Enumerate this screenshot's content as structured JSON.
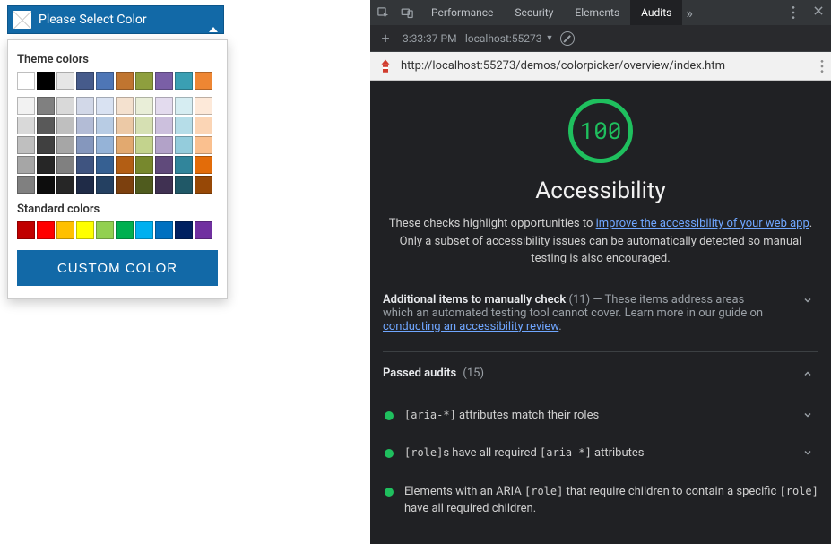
{
  "picker": {
    "placeholder": "Please Select Color",
    "theme_header": "Theme colors",
    "standard_header": "Standard colors",
    "custom_button": "CUSTOM COLOR",
    "theme_rows": [
      [
        "#ffffff",
        "#000000",
        "#e6e6e6",
        "#465b8b",
        "#4e76b6",
        "#c07530",
        "#8e9f3e",
        "#7a5fa6",
        "#3a9fb3",
        "#ee8633"
      ],
      [
        "#f2f2f2",
        "#808080",
        "#d9d9d9",
        "#d2d8e8",
        "#d9e2f2",
        "#f4e1cf",
        "#e9eed8",
        "#e3dbee",
        "#d6edf2",
        "#fde9d9"
      ],
      [
        "#d9d9d9",
        "#595959",
        "#bfbfbf",
        "#b3bcd6",
        "#b8cce4",
        "#ecc9a6",
        "#d6e0b3",
        "#ccc0dd",
        "#b6dde8",
        "#fbd5b5"
      ],
      [
        "#bfbfbf",
        "#404040",
        "#a6a6a6",
        "#8597bd",
        "#95b3d7",
        "#e2a96f",
        "#c3d38d",
        "#b2a2c8",
        "#94ccdc",
        "#fac08f"
      ],
      [
        "#a6a6a6",
        "#262626",
        "#808080",
        "#3f5480",
        "#366092",
        "#b35e14",
        "#77882d",
        "#604a7b",
        "#31859b",
        "#e36c09"
      ],
      [
        "#808080",
        "#0d0d0d",
        "#262626",
        "#1f2b47",
        "#244061",
        "#7c400e",
        "#4f5b1e",
        "#403152",
        "#205867",
        "#974806"
      ]
    ],
    "standard_colors": [
      "#c00000",
      "#ff0000",
      "#ffc000",
      "#ffff00",
      "#92d050",
      "#00b050",
      "#00b0f0",
      "#0070c0",
      "#002060",
      "#7030a0"
    ]
  },
  "devtools": {
    "tabs": [
      "Performance",
      "Security",
      "Elements",
      "Audits"
    ],
    "active_tab": "Audits",
    "timestamp": "3:33:37 PM - localhost:55273",
    "url": "http://localhost:55273/demos/colorpicker/overview/index.htm",
    "gauge_score": "100",
    "gauge_title": "Accessibility",
    "gauge_desc_prefix": "These checks highlight opportunities to ",
    "gauge_desc_link1": "improve the accessibility of your web app",
    "gauge_desc_suffix": ". Only a subset of accessibility issues can be automatically detected so manual testing is also encouraged.",
    "manual": {
      "title": "Additional items to manually check",
      "count": "(11)",
      "dash": "  —  ",
      "desc": "These items address areas which an automated testing tool cannot cover. Learn more in our guide on ",
      "link": "conducting an accessibility review",
      "period": "."
    },
    "passed": {
      "title": "Passed audits",
      "count": "(15)"
    },
    "audits": [
      {
        "pre": "",
        "code1": "[aria-*]",
        "mid": " attributes match their roles",
        "code2": "",
        "post": ""
      },
      {
        "pre": "",
        "code1": "[role]",
        "mid": "s have all required ",
        "code2": "[aria-*]",
        "post": " attributes"
      },
      {
        "pre": "Elements with an ARIA ",
        "code1": "[role]",
        "mid": " that require children to contain a specific ",
        "code2": "[role]",
        "post": " have all required children."
      }
    ]
  }
}
